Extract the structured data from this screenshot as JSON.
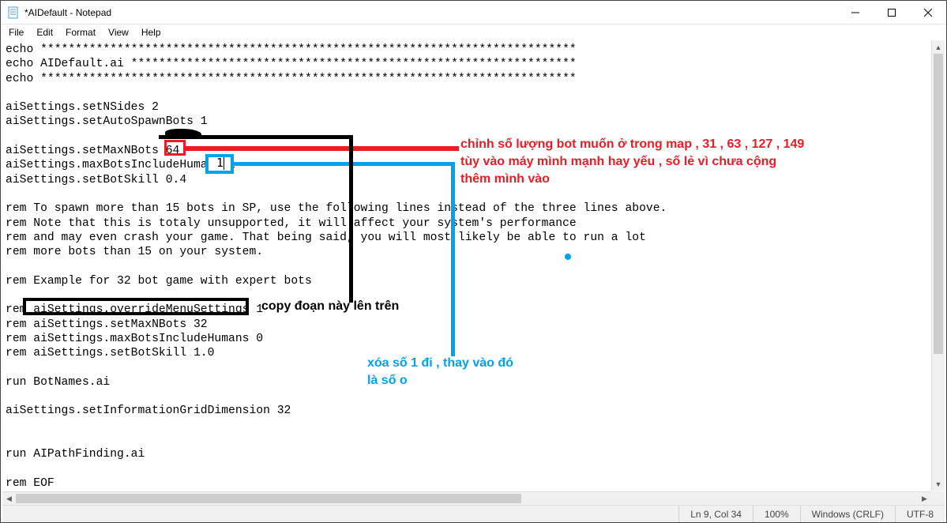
{
  "window": {
    "title": "*AIDefault - Notepad"
  },
  "menu": {
    "file": "File",
    "edit": "Edit",
    "format": "Format",
    "view": "View",
    "help": "Help"
  },
  "content": {
    "text": "echo *****************************************************************************\necho AIDefault.ai ****************************************************************\necho *****************************************************************************\n\naiSettings.setNSides 2\naiSettings.setAutoSpawnBots 1\n\naiSettings.setMaxNBots 64\naiSettings.maxBotsIncludeHumans 1\naiSettings.setBotSkill 0.4\n\nrem To spawn more than 15 bots in SP, use the following lines instead of the three lines above.\nrem Note that this is totaly unsupported, it will affect your system's performance\nrem and may even crash your game. That being said, you will most likely be able to run a lot\nrem more bots than 15 on your system.\n\nrem Example for 32 bot game with expert bots\n\nrem aiSettings.overrideMenuSettings 1\nrem aiSettings.setMaxNBots 32\nrem aiSettings.maxBotsIncludeHumans 0\nrem aiSettings.setBotSkill 1.0\n\nrun BotNames.ai\n\naiSettings.setInformationGridDimension 32\n\n\nrun AIPathFinding.ai\n\nrem EOF"
  },
  "status": {
    "pos": "Ln 9, Col 34",
    "zoom": "100%",
    "eol": "Windows (CRLF)",
    "encoding": "UTF-8"
  },
  "annotations": {
    "red_text": "chỉnh số lượng bot muốn ở trong map , 31 , 63 , 127 , 149\ntùy vào máy mình mạnh hay yếu , số lẻ vì chưa cộng\nthêm mình vào",
    "blue_text": "xóa số 1 đi , thay vào đó\nlà số o",
    "black_text": "copy đoạn này lên trên"
  }
}
